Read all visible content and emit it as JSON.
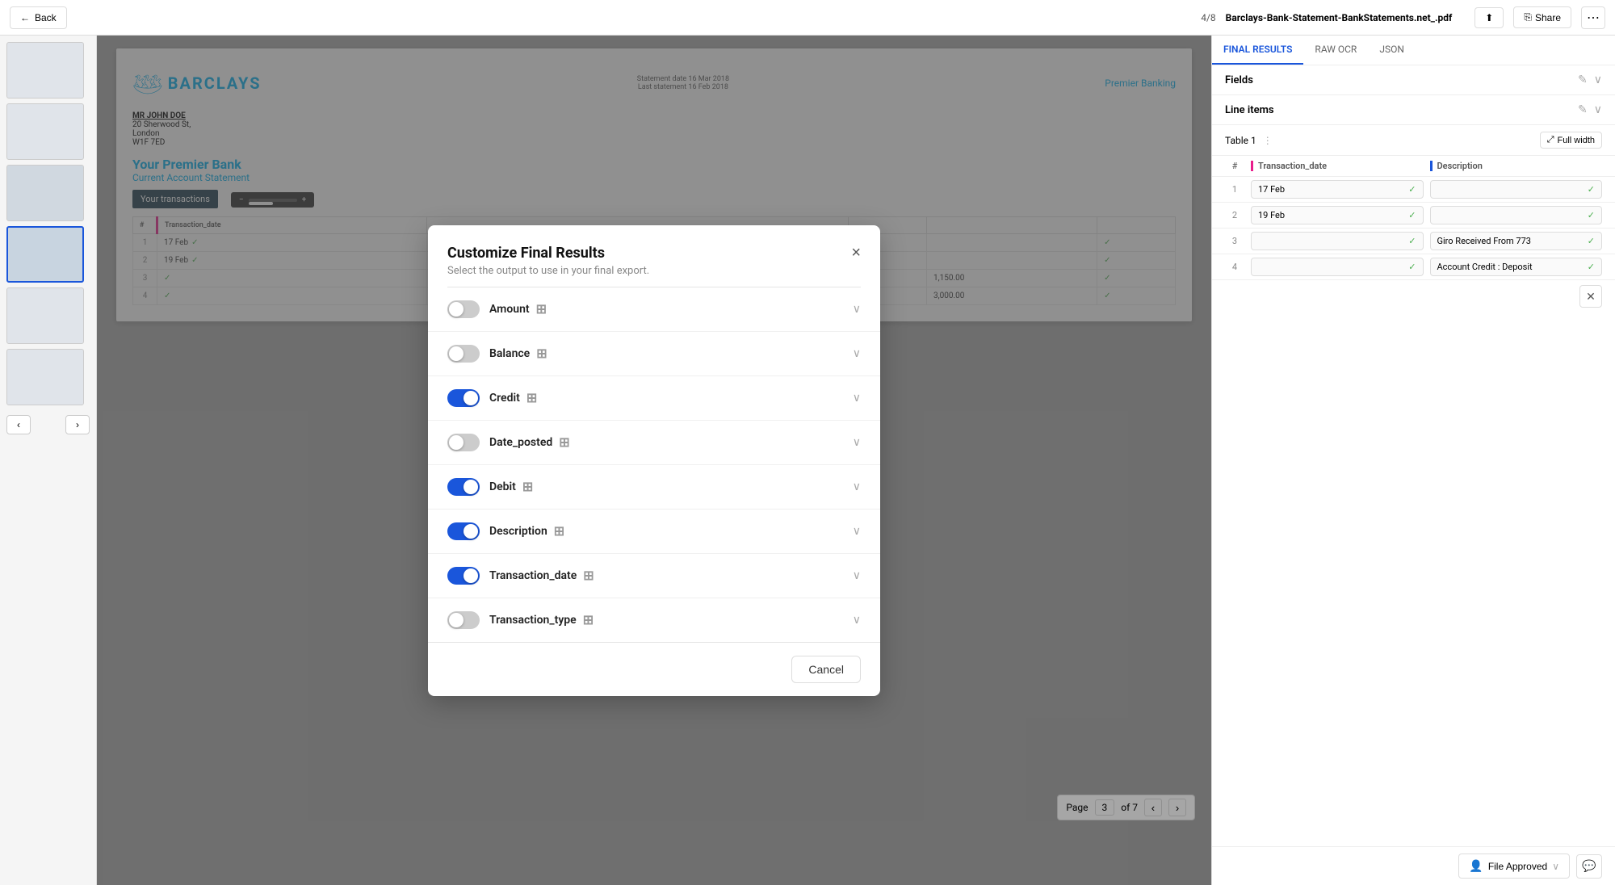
{
  "topbar": {
    "back_label": "Back",
    "file_page": "4/8",
    "file_name": "Barclays-Bank-Statement-BankStatements.net_.pdf"
  },
  "document": {
    "bank_name": "BARCLAYS",
    "statement_date": "Statement date 16 Mar 2018",
    "last_statement": "Last statement 16 Feb 2018",
    "premier_banking": "Premier Banking",
    "address": {
      "name": "MR JOHN DOE",
      "line1": "20 Sherwood St,",
      "line2": "London",
      "line3": "W1F 7ED"
    },
    "premier_title": "Your Premier Bank",
    "account_statement": "Current Account Statement",
    "transactions_label": "Your transactions",
    "page_info": "Page 3 of 7"
  },
  "table": {
    "headers": [
      "#",
      "Transaction_date",
      "Description",
      "",
      "",
      ""
    ],
    "rows": [
      {
        "num": "1",
        "date": "17 Feb",
        "desc": "",
        "col3": "",
        "col4": "",
        "col5": ""
      },
      {
        "num": "2",
        "date": "19 Feb",
        "desc": "",
        "col3": "",
        "col4": "",
        "col5": ""
      },
      {
        "num": "3",
        "date": "",
        "desc": "Giro Received From 773",
        "col3": "",
        "col4": "1,150.00",
        "col5": ""
      },
      {
        "num": "4",
        "date": "",
        "desc": "Account Credit : Deposit",
        "col3": "",
        "col4": "3,000.00",
        "col5": ""
      }
    ]
  },
  "right_panel": {
    "tabs": [
      "FINAL RESULTS",
      "RAW OCR",
      "JSON"
    ],
    "active_tab": "FINAL RESULTS",
    "fields_label": "Fields",
    "line_items_label": "Line items",
    "table_label": "Table 1",
    "full_width_label": "Full width",
    "col1_header": "Transaction_date",
    "col2_header": "Description",
    "file_approved_label": "File Approved",
    "share_label": "Share"
  },
  "modal": {
    "title": "Customize Final Results",
    "subtitle": "Select the output to use in your final export.",
    "close_label": "×",
    "cancel_label": "Cancel",
    "fields": [
      {
        "id": "amount",
        "label": "Amount",
        "icon": "⊞",
        "enabled": false
      },
      {
        "id": "balance",
        "label": "Balance",
        "icon": "⊞",
        "enabled": false
      },
      {
        "id": "credit",
        "label": "Credit",
        "icon": "⊞",
        "enabled": true
      },
      {
        "id": "date_posted",
        "label": "Date_posted",
        "icon": "⊞",
        "enabled": false
      },
      {
        "id": "debit",
        "label": "Debit",
        "icon": "⊞",
        "enabled": true
      },
      {
        "id": "description",
        "label": "Description",
        "icon": "⊞",
        "enabled": true
      },
      {
        "id": "transaction_date",
        "label": "Transaction_date",
        "icon": "⊞",
        "enabled": true
      },
      {
        "id": "transaction_type",
        "label": "Transaction_type",
        "icon": "⊞",
        "enabled": false
      }
    ]
  },
  "colors": {
    "blue": "#1a56db",
    "teal": "#00aeef",
    "pink": "#e91e8c",
    "green": "#4caf50"
  }
}
